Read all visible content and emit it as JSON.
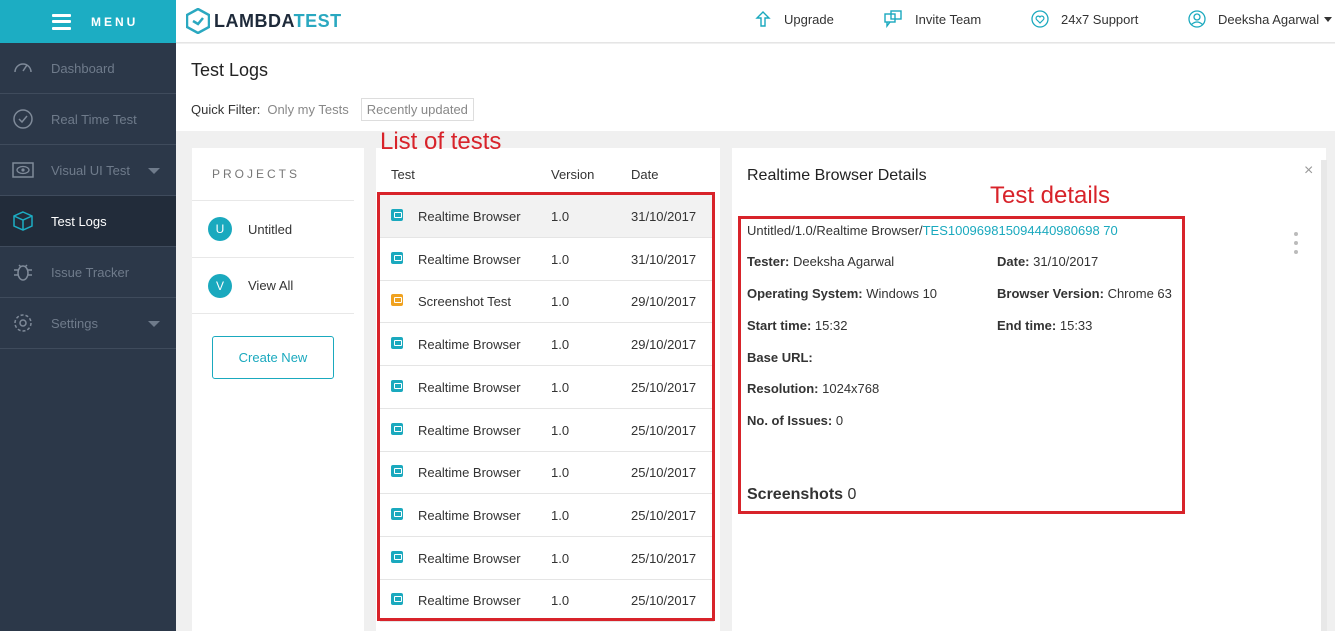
{
  "sidebar": {
    "menu_label": "MENU",
    "items": [
      {
        "label": "Dashboard",
        "icon": "gauge-icon",
        "active": false,
        "has_caret": false
      },
      {
        "label": "Real Time Test",
        "icon": "clock-icon",
        "active": false,
        "has_caret": false
      },
      {
        "label": "Visual UI Test",
        "icon": "eye-icon",
        "active": false,
        "has_caret": true
      },
      {
        "label": "Test Logs",
        "icon": "cube-icon",
        "active": true,
        "has_caret": false
      },
      {
        "label": "Issue Tracker",
        "icon": "bug-icon",
        "active": false,
        "has_caret": false
      },
      {
        "label": "Settings",
        "icon": "gear-icon",
        "active": false,
        "has_caret": true
      }
    ]
  },
  "topbar": {
    "logo_prefix": "LAMBDA",
    "logo_suffix": "TEST",
    "upgrade": "Upgrade",
    "invite": "Invite Team",
    "support": "24x7 Support",
    "user": "Deeksha Agarwal"
  },
  "page": {
    "title": "Test Logs",
    "quick_filter_label": "Quick Filter:",
    "filter_only_mine": "Only my Tests",
    "filter_recent": "Recently updated"
  },
  "projects": {
    "heading": "PROJECTS",
    "items": [
      {
        "badge": "U",
        "label": "Untitled"
      },
      {
        "badge": "V",
        "label": "View All"
      }
    ],
    "create_button": "Create New"
  },
  "tests": {
    "columns": {
      "test": "Test",
      "version": "Version",
      "date": "Date"
    },
    "rows": [
      {
        "name": "Realtime Browser",
        "version": "1.0",
        "date": "31/10/2017",
        "type": "realtime"
      },
      {
        "name": "Realtime Browser",
        "version": "1.0",
        "date": "31/10/2017",
        "type": "realtime"
      },
      {
        "name": "Screenshot Test",
        "version": "1.0",
        "date": "29/10/2017",
        "type": "screenshot"
      },
      {
        "name": "Realtime Browser",
        "version": "1.0",
        "date": "29/10/2017",
        "type": "realtime"
      },
      {
        "name": "Realtime Browser",
        "version": "1.0",
        "date": "25/10/2017",
        "type": "realtime"
      },
      {
        "name": "Realtime Browser",
        "version": "1.0",
        "date": "25/10/2017",
        "type": "realtime"
      },
      {
        "name": "Realtime Browser",
        "version": "1.0",
        "date": "25/10/2017",
        "type": "realtime"
      },
      {
        "name": "Realtime Browser",
        "version": "1.0",
        "date": "25/10/2017",
        "type": "realtime"
      },
      {
        "name": "Realtime Browser",
        "version": "1.0",
        "date": "25/10/2017",
        "type": "realtime"
      },
      {
        "name": "Realtime Browser",
        "version": "1.0",
        "date": "25/10/2017",
        "type": "realtime"
      }
    ]
  },
  "details": {
    "title": "Realtime Browser Details",
    "close": "×",
    "path": "Untitled/1.0/Realtime Browser/",
    "test_id": "TES100969815094440980698 70",
    "tester_label": "Tester:",
    "tester": "Deeksha Agarwal",
    "date_label": "Date:",
    "date": "31/10/2017",
    "os_label": "Operating System:",
    "os": "Windows 10",
    "browser_label": "Browser Version:",
    "browser": "Chrome 63",
    "start_label": "Start time:",
    "start": "15:32",
    "end_label": "End time:",
    "end": "15:33",
    "base_url_label": "Base URL:",
    "resolution_label": "Resolution:",
    "resolution": "1024x768",
    "issues_label": "No. of Issues:",
    "issues": "0",
    "screenshots_label": "Screenshots",
    "screenshots": "0"
  },
  "annotations": {
    "list_label": "List of tests",
    "details_label": "Test details"
  },
  "colors": {
    "accent": "#1aa9be",
    "sidebar": "#2c3849",
    "annotation": "#d8232a",
    "screenshot_icon": "#f0a21f"
  }
}
